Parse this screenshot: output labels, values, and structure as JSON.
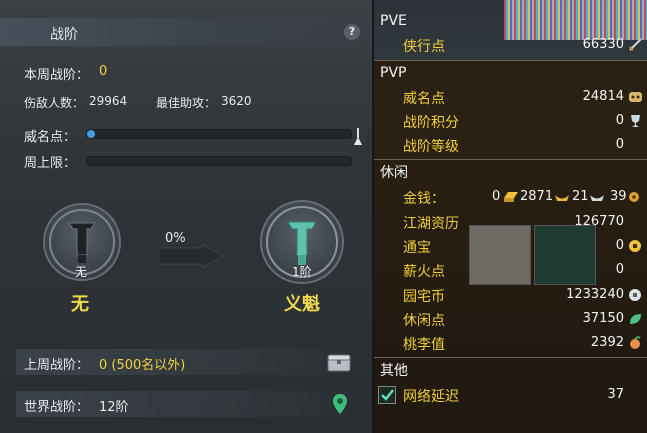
{
  "left": {
    "tab_label": "战阶",
    "help_label": "?",
    "weekly_rank_label": "本周战阶：",
    "weekly_rank_value": "0",
    "kills_label": "伤敌人数：",
    "kills_value": "29964",
    "assists_label": "最佳助攻：",
    "assists_value": "3620",
    "prestige_label": "威名点：",
    "prestige_progress": 0.03,
    "weekly_cap_label": "周上限：",
    "weekly_cap_progress": 0,
    "current_rank_sub": "无",
    "current_rank_name": "无",
    "progress_percent": "0%",
    "next_rank_sub": "1阶",
    "next_rank_name": "义魁",
    "last_week_label": "上周战阶：",
    "last_week_value": "0 (500名以外)",
    "world_rank_label": "世界战阶：",
    "world_rank_value": "12阶"
  },
  "right": {
    "pve_header": "PVE",
    "pve_rows": [
      {
        "name": "侠行点",
        "value": "66330",
        "icon": "sword-icon"
      }
    ],
    "pvp_header": "PVP",
    "pvp_rows": [
      {
        "name": "威名点",
        "value": "24814",
        "icon": "mask-icon"
      },
      {
        "name": "战阶积分",
        "value": "0",
        "icon": "trophy-icon"
      },
      {
        "name": "战阶等级",
        "value": "0",
        "icon": ""
      }
    ],
    "leisure_header": "休闲",
    "money": {
      "name": "金钱：",
      "gold_brick": "0",
      "gold_ingot": "2871",
      "silver_ingot": "21",
      "coin": "39"
    },
    "leisure_rows": [
      {
        "name": "江湖资历",
        "value": "126770",
        "icon": ""
      },
      {
        "name": "通宝",
        "value": "0",
        "icon": "tongbao-coin-icon"
      },
      {
        "name": "薪火点",
        "value": "0",
        "icon": ""
      },
      {
        "name": "园宅币",
        "value": "1233240",
        "icon": "house-coin-icon"
      },
      {
        "name": "休闲点",
        "value": "37150",
        "icon": "leaf-icon"
      },
      {
        "name": "桃李值",
        "value": "2392",
        "icon": "peach-icon"
      }
    ],
    "other_header": "其他",
    "latency_name": "网络延迟",
    "latency_value": "37",
    "latency_checked": true
  }
}
